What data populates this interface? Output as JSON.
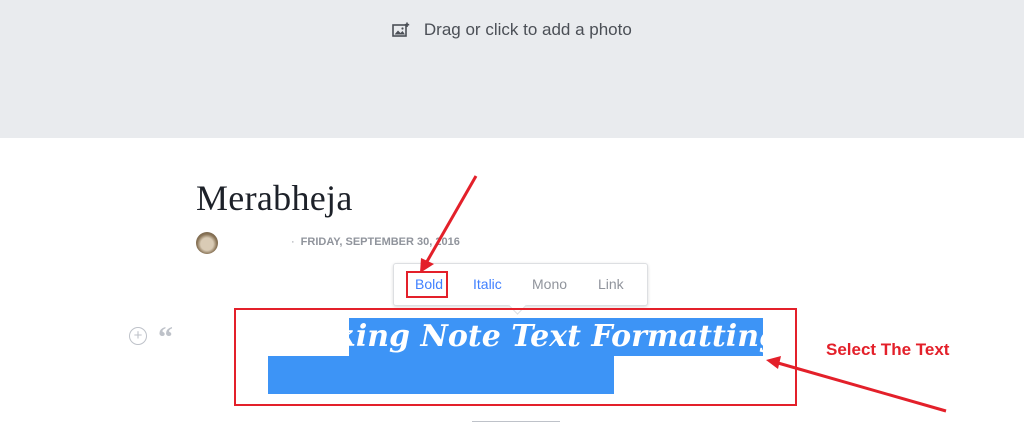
{
  "photo": {
    "prompt": "Drag or click to add a photo",
    "icon": "photo-add-icon"
  },
  "note": {
    "title": "Merabheja",
    "date": "FRIDAY, SEPTEMBER 30, 2016",
    "separator": "·",
    "text": "Checking Note Text Formatting"
  },
  "toolbar": {
    "bold": "Bold",
    "italic": "Italic",
    "mono": "Mono",
    "link": "Link"
  },
  "side_buttons": {
    "add": "+",
    "quote": "“"
  },
  "annotation": {
    "label": "Select The Text"
  },
  "colors": {
    "accent": "#4080ff",
    "selection": "#3d94f6",
    "annotation": "#e3202a",
    "photo_bg": "#e9ebee"
  }
}
